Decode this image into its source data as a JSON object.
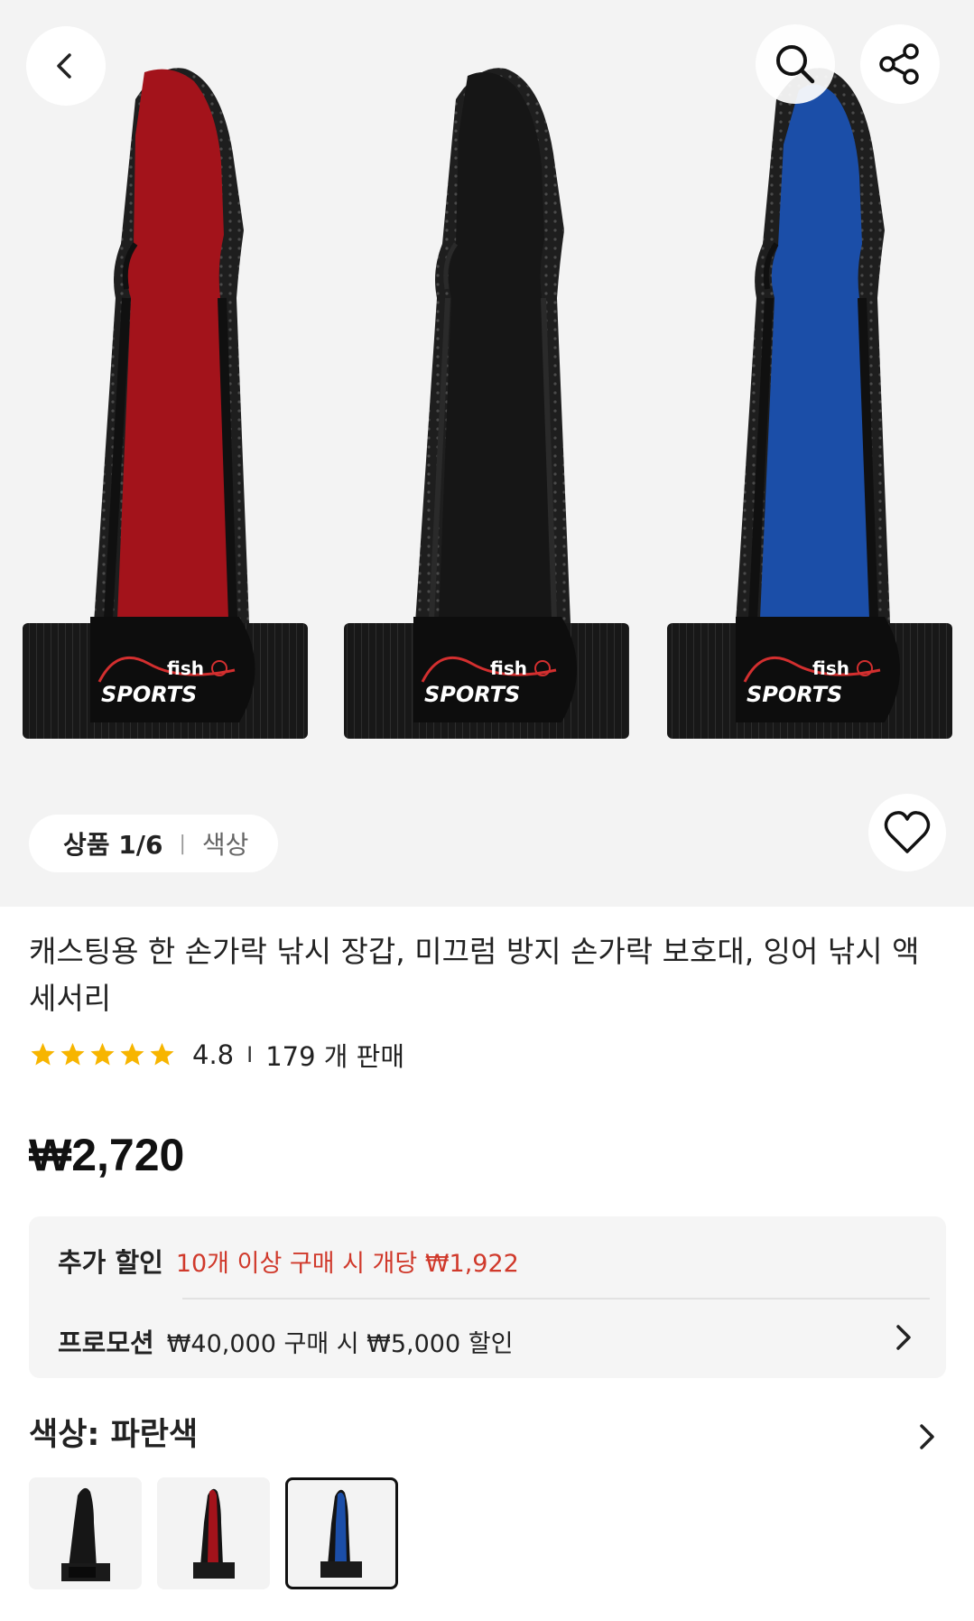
{
  "gallery": {
    "counter": "상품 1/6",
    "tag": "색상",
    "brand_text_1": "fish",
    "brand_text_2": "SPORTS"
  },
  "icons": {
    "back": "chevron-left-icon",
    "search": "search-icon",
    "share": "share-icon",
    "wishlist": "heart-icon"
  },
  "product": {
    "title": "캐스팅용 한 손가락 낚시 장갑, 미끄럼 방지 손가락 보호대, 잉어 낚시 액세서리",
    "rating": "4.8",
    "rating_sep": "I",
    "sold": "179 개 판매",
    "stars_filled": 5,
    "price": "₩2,720"
  },
  "promotions": {
    "extra_discount_label": "추가 할인",
    "extra_discount_text": "10개 이상 구매 시 개당 ₩1,922",
    "promotion_label": "프로모션",
    "promotion_text": "₩40,000 구매 시 ₩5,000 할인"
  },
  "color": {
    "title": "색상: 파란색",
    "options": [
      "black",
      "red",
      "blue"
    ],
    "selected": "blue"
  },
  "colors": {
    "red_accent": "#d0392b",
    "star": "#f7b500",
    "product_red": "#a3131b",
    "product_blue": "#1b4ea8",
    "product_black": "#161616"
  }
}
